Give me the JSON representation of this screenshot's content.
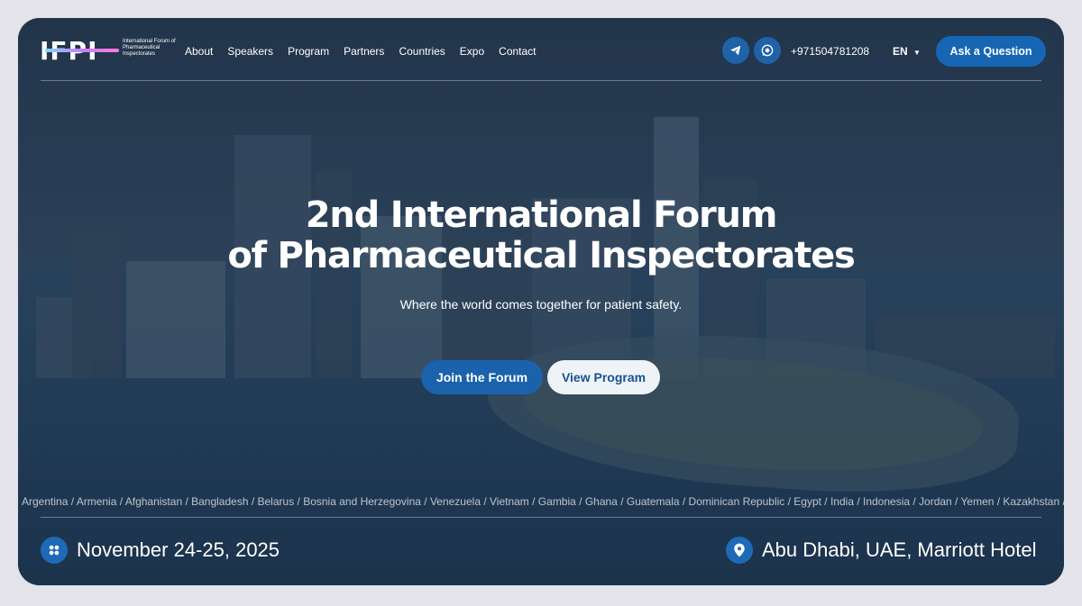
{
  "logo": {
    "mark": "IFPI",
    "subtext": "International Forum of Pharmaceutical Inspectorates"
  },
  "nav": [
    "About",
    "Speakers",
    "Program",
    "Partners",
    "Countries",
    "Expo",
    "Contact"
  ],
  "header": {
    "phone": "+971504781208",
    "language": "EN",
    "ask_button": "Ask a Question",
    "icons": [
      "telegram-icon",
      "whatsapp-icon"
    ]
  },
  "hero": {
    "title_line1": "2nd International Forum",
    "title_line2": "of Pharmaceutical Inspectorates",
    "subtitle": "Where the world comes together for patient safety.",
    "join_button": "Join the Forum",
    "view_button": "View Program"
  },
  "countries_ticker": "Argentina / Armenia / Afghanistan / Bangladesh / Belarus / Bosnia and Herzegovina / Venezuela / Vietnam / Gambia / Ghana / Guatemala / Dominican Republic / Egypt / India / Indonesia / Jordan / Yemen / Kazakhstan / Car",
  "event": {
    "date": "November 24-25, 2025",
    "location": "Abu Dhabi, UAE, Marriott Hotel"
  },
  "colors": {
    "accent": "#1766b3",
    "page_background": "#e4e3ea",
    "overlay": "#2c3f55"
  }
}
